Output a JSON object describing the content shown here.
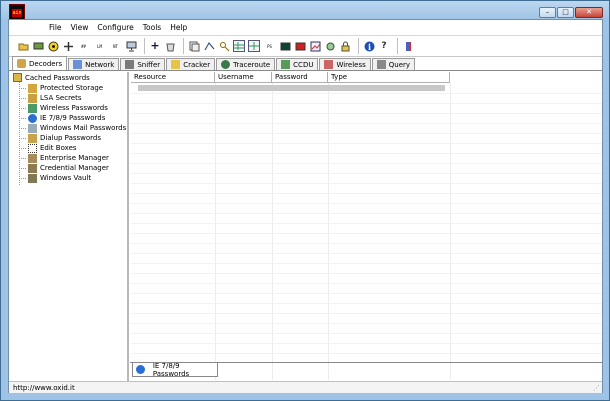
{
  "menu": [
    "File",
    "View",
    "Configure",
    "Tools",
    "Help"
  ],
  "window_buttons": {
    "minimize": "–",
    "maximize": "□",
    "close": "✕"
  },
  "app_icon_text": "ain",
  "toolbar": {
    "labels": {
      "hash1": "##",
      "hash2": "#a",
      "lm": "LM",
      "ntlm": "NT",
      "b": "B",
      "ps1": "PS",
      "ps2": "PS"
    }
  },
  "tabs": [
    "Decoders",
    "Network",
    "Sniffer",
    "Cracker",
    "Traceroute",
    "CCDU",
    "Wireless",
    "Query"
  ],
  "tree": {
    "root": "Cached Passwords",
    "items": [
      "Protected Storage",
      "LSA Secrets",
      "Wireless Passwords",
      "IE 7/8/9 Passwords",
      "Windows Mail Passwords",
      "Dialup Passwords",
      "Edit Boxes",
      "Enterprise Manager",
      "Credential Manager",
      "Windows Vault"
    ]
  },
  "columns": [
    "Resource",
    "Username",
    "Password",
    "Type"
  ],
  "bottom_tab": "IE 7/8/9 Passwords",
  "status": "http://www.oxid.it",
  "colors": {
    "titlebar": "#9dc2e5",
    "frame": "#9ec3e6",
    "selection": "#c8c8c8"
  }
}
